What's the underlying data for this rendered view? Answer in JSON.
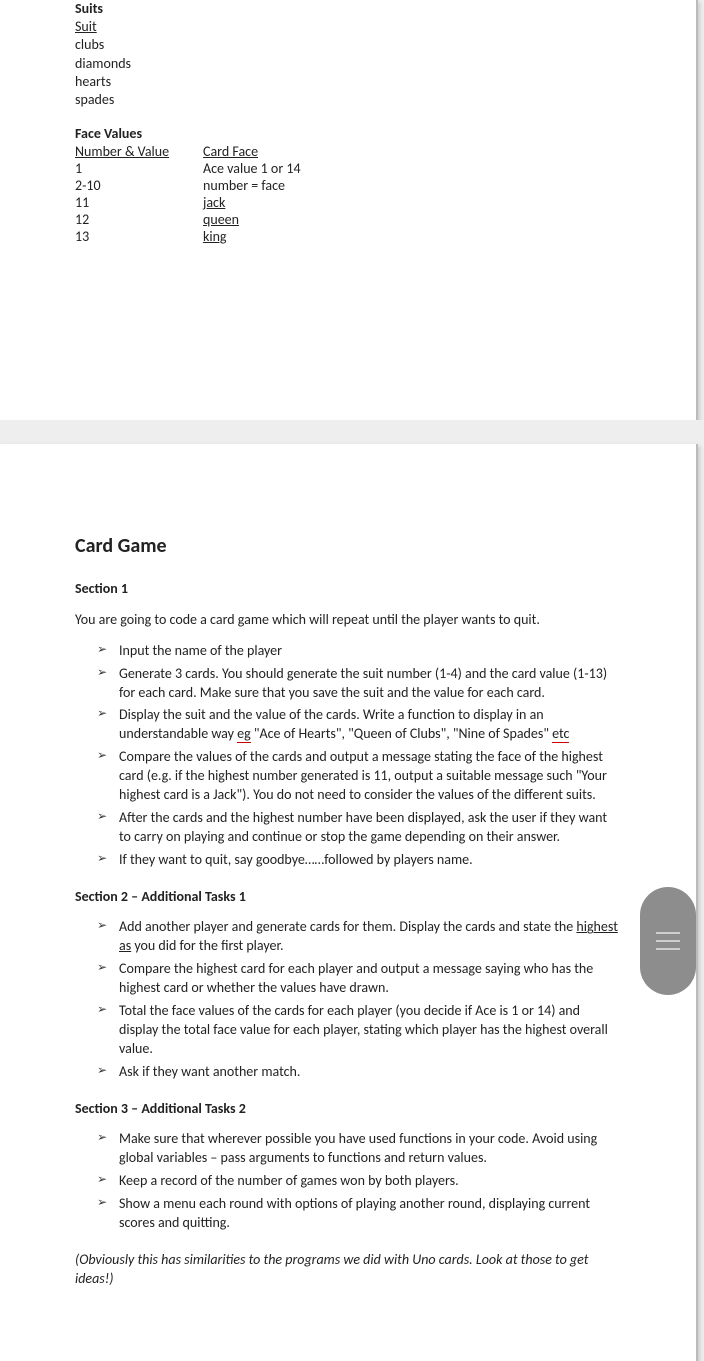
{
  "page1": {
    "suits_heading": "Suits",
    "suit_col": "Suit",
    "suits": [
      "clubs",
      "diamonds",
      "hearts",
      "spades"
    ],
    "fv_heading": "Face Values",
    "fv_col1": "Number & Value",
    "fv_col2": "Card Face",
    "fv_rows": [
      {
        "n": "1",
        "f": "Ace value 1 or 14",
        "link": false
      },
      {
        "n": "2-10",
        "f": "number = face",
        "link": false
      },
      {
        "n": "11",
        "f": "jack",
        "link": true
      },
      {
        "n": "12",
        "f": "queen",
        "link": true
      },
      {
        "n": "13",
        "f": "king",
        "link": true
      }
    ]
  },
  "page2": {
    "title": "Card Game",
    "sec1_h": "Section 1",
    "sec1_p": "You are going to code a card game which will repeat until the player wants to quit.",
    "sec1_items": [
      {
        "pre": "Input the name of the player",
        "eg": "",
        "post": ""
      },
      {
        "pre": "Generate 3 cards. You should generate the suit number (1-4) and the card value (1-13) for each card. Make sure that you save the suit and the value for each card.",
        "eg": "",
        "post": ""
      },
      {
        "pre": "Display the suit and the value of the cards. Write a function to display in an understandable way ",
        "eg": "eg",
        "post": " \"Ace of Hearts\", \"Queen of Clubs\", \"Nine of Spades\" ",
        "etc": "etc"
      },
      {
        "pre": " Compare the values of the cards and output a message stating the face of the highest card (e.g. if the highest number generated is 11, output a suitable message such \"Your highest card is a Jack\"). You do not need to consider the values of the different suits.",
        "eg": "",
        "post": ""
      },
      {
        "pre": "After the cards and the highest number have been displayed, ask the user if they want to carry on playing and continue or stop the game depending on their answer.",
        "eg": "",
        "post": ""
      },
      {
        "pre": "If they want to quit, say goodbye……followed by players name.",
        "eg": "",
        "post": ""
      }
    ],
    "sec2_h": "Section 2 – Additional Tasks 1",
    "sec2_items": [
      {
        "pre": "Add another player and generate cards for them. Display the cards and state the ",
        "high": "highest  as",
        "post": " you did for the first player."
      },
      {
        "pre": " Compare the highest card for each player and output a message saying who has the highest card or whether the values have drawn.",
        "high": "",
        "post": ""
      },
      {
        "pre": " Total the face values of the cards for each player (you decide if Ace is 1 or 14) and display the total face value for each player, stating which player has the highest overall value.",
        "high": "",
        "post": ""
      },
      {
        "pre": "Ask if they want another match.",
        "high": "",
        "post": ""
      }
    ],
    "sec3_h": "Section 3 – Additional Tasks 2",
    "sec3_items": [
      "Make sure that wherever possible you have used functions in your code. Avoid using global variables – pass arguments to functions and return values.",
      " Keep a record of the number of games won by both players.",
      "Show a menu each round with options of playing another round, displaying current scores and quitting."
    ],
    "footnote": "(Obviously this has similarities to the programs we did with Uno cards. Look at those to get ideas!)"
  }
}
